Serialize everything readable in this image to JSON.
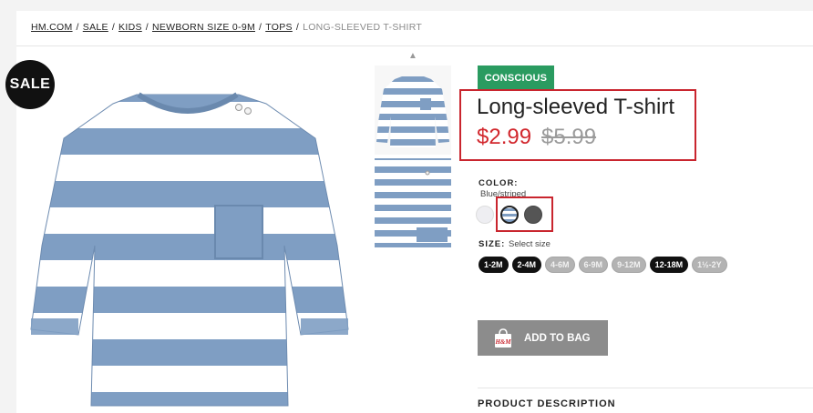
{
  "breadcrumb": {
    "items": [
      "HM.COM",
      "SALE",
      "KIDS",
      "NEWBORN SIZE 0-9M",
      "TOPS"
    ],
    "current": "LONG-SLEEVED T-SHIRT",
    "separator": "/"
  },
  "badges": {
    "sale": "SALE",
    "conscious": "CONSCIOUS"
  },
  "product": {
    "title": "Long-sleeved T-shirt",
    "price_sale": "$2.99",
    "price_original": "$5.99"
  },
  "color": {
    "label": "COLOR:",
    "selected": "Blue/striped",
    "swatches": [
      "light-lilac",
      "blue-striped",
      "dark-gray"
    ]
  },
  "size": {
    "label": "SIZE:",
    "hint": "Select size",
    "options": [
      {
        "label": "1-2M",
        "available": true
      },
      {
        "label": "2-4M",
        "available": true
      },
      {
        "label": "4-6M",
        "available": false
      },
      {
        "label": "6-9M",
        "available": false
      },
      {
        "label": "9-12M",
        "available": false
      },
      {
        "label": "12-18M",
        "available": true
      },
      {
        "label": "1½-2Y",
        "available": false
      }
    ]
  },
  "cart": {
    "add_label": "ADD TO BAG",
    "bag_logo": "H&M"
  },
  "description": {
    "title": "PRODUCT DESCRIPTION"
  },
  "colors": {
    "accent_red": "#d2282e",
    "conscious_green": "#2a9b60",
    "stripe_blue": "#7f9ec3",
    "button_gray": "#8c8c8c",
    "annotation_red": "#c9252e"
  }
}
